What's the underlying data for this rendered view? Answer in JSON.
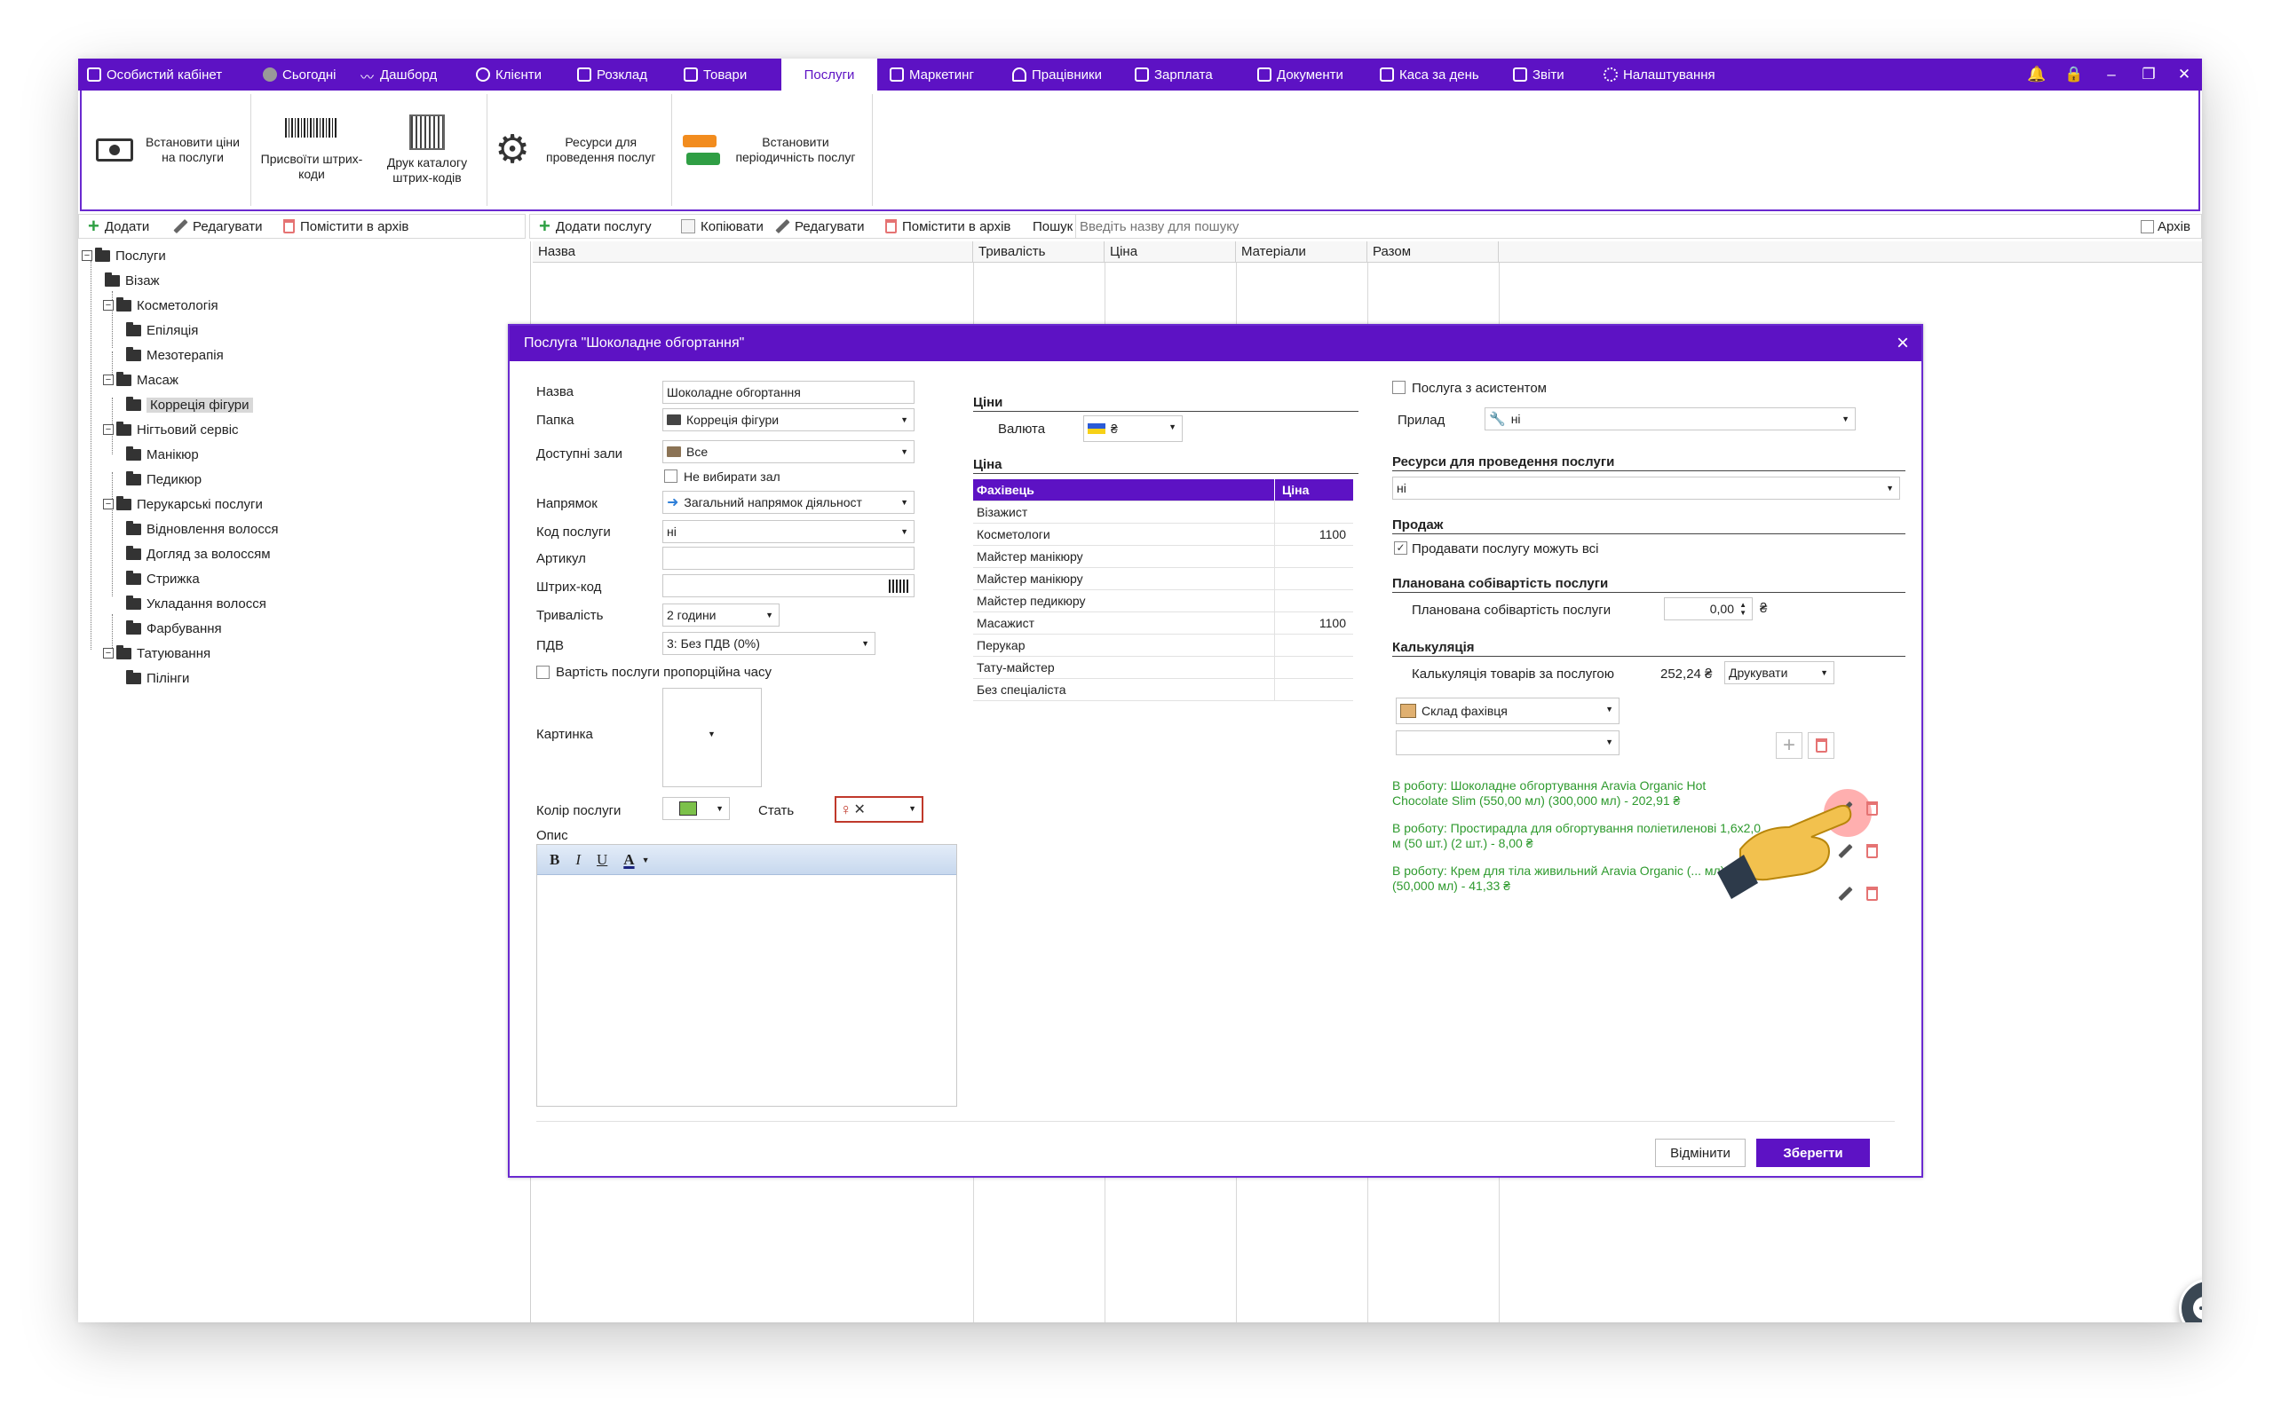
{
  "menu": {
    "items": [
      {
        "id": "cabinet",
        "label": "Особистий кабінет"
      },
      {
        "id": "today",
        "label": "Сьогодні"
      },
      {
        "id": "dashboard",
        "label": "Дашборд"
      },
      {
        "id": "clients",
        "label": "Клієнти"
      },
      {
        "id": "schedule",
        "label": "Розклад"
      },
      {
        "id": "goods",
        "label": "Товари"
      },
      {
        "id": "services",
        "label": "Послуги"
      },
      {
        "id": "marketing",
        "label": "Маркетинг"
      },
      {
        "id": "staff",
        "label": "Працівники"
      },
      {
        "id": "salary",
        "label": "Зарплата"
      },
      {
        "id": "documents",
        "label": "Документи"
      },
      {
        "id": "cashday",
        "label": "Каса за день"
      },
      {
        "id": "reports",
        "label": "Звіти"
      },
      {
        "id": "settings",
        "label": "Налаштування"
      }
    ],
    "active": "Послуги"
  },
  "ribbon": {
    "set_prices": "Встановити ціни на послуги",
    "assign_barcodes": "Присвоїти штрих-коди",
    "print_barcodes": "Друк каталогу штрих-кодів",
    "resources": "Ресурси для проведення послуг",
    "periodicity": "Встановити періодичність послуг"
  },
  "left_toolbar": {
    "add": "Додати",
    "edit": "Редагувати",
    "archive": "Помістити в архів"
  },
  "main_toolbar": {
    "add_service": "Додати послугу",
    "copy": "Копіювати",
    "edit": "Редагувати",
    "archive": "Помістити в архів",
    "search_label": "Пошук",
    "search_placeholder": "Введіть назву для пошуку",
    "archive_toggle": "Архів"
  },
  "tree": {
    "root": "Послуги",
    "visage": "Візаж",
    "cosmetology": "Косметологія",
    "epilation": "Епіляція",
    "mesotherapy": "Мезотерапія",
    "massage": "Масаж",
    "correction": "Корреція фігури",
    "nail": "Нігтьовий сервіс",
    "manicure": "Манікюр",
    "pedicure": "Педикюр",
    "hair": "Перукарські послуги",
    "hair_restore": "Відновлення волосся",
    "hair_care": "Догляд за волоссям",
    "haircut": "Стрижка",
    "styling": "Укладання волосся",
    "coloring": "Фарбування",
    "tattoo": "Татуювання",
    "peeling": "Пілінги"
  },
  "grid": {
    "columns": [
      "Назва",
      "Тривалість",
      "Ціна",
      "Матеріали",
      "Разом"
    ]
  },
  "dialog": {
    "title": "Послуга \"Шоколадне обгортання\"",
    "close": "×",
    "labels": {
      "name": "Назва",
      "folder": "Папка",
      "halls": "Доступні зали",
      "direction": "Напрямок",
      "code": "Код послуги",
      "article": "Артикул",
      "barcode": "Штрих-код",
      "duration": "Тривалість",
      "vat": "ПДВ",
      "picture": "Картинка",
      "color": "Колір послуги",
      "gender": "Стать",
      "description": "Опис"
    },
    "values": {
      "name": "Шоколадне обгортання",
      "folder": "Корреція фігури",
      "halls": "Все",
      "no_halls": "Не вибирати зал",
      "direction": "Загальний напрямок діяльност",
      "code": "ні",
      "article": "",
      "barcode": "",
      "duration": "2 години",
      "vat": "3: Без ПДВ (0%)",
      "proportional": "Вартість послуги пропорційна часу"
    },
    "color_service": "#7cc14a",
    "editor": {
      "bold": "B",
      "italic": "I",
      "underline": "U",
      "fontcolor": "A"
    },
    "prices": {
      "section": "Ціни",
      "currency_label": "Валюта",
      "currency_value": "₴",
      "price_section": "Ціна",
      "table_head": {
        "specialist": "Фахівець",
        "price": "Ціна"
      },
      "rows": [
        {
          "specialist": "Візажист",
          "price": ""
        },
        {
          "specialist": "Косметологи",
          "price": "1100"
        },
        {
          "specialist": "Майстер манікюру",
          "price": ""
        },
        {
          "specialist": "Майстер манікюру",
          "price": ""
        },
        {
          "specialist": "Майстер педикюру",
          "price": ""
        },
        {
          "specialist": "Масажист",
          "price": "1100"
        },
        {
          "specialist": "Перукар",
          "price": ""
        },
        {
          "specialist": "Тату-майстер",
          "price": ""
        },
        {
          "specialist": "Без спеціаліста",
          "price": ""
        }
      ]
    },
    "right": {
      "assistant": "Послуга з асистентом",
      "device_label": "Прилад",
      "device_value": "ні",
      "resources_section": "Ресурси для проведення послуги",
      "resources_value": "ні",
      "sale_section": "Продаж",
      "sale_all": "Продавати послугу можуть всі",
      "cost_section": "Планована собівартість послуги",
      "cost_label": "Планована собівартість послуги",
      "cost_value": "0,00",
      "cost_currency": "₴",
      "calc_section": "Калькуляція",
      "calc_label": "Калькуляція товарів за послугою",
      "calc_value": "252,24 ₴",
      "print": "Друкувати",
      "warehouse": "Склад фахівця",
      "items": [
        {
          "text": "В роботу: Шоколадне обгортування Aravia Organic Hot Chocolate Slim (550,00 мл) (300,000 мл) - 202,91 ₴"
        },
        {
          "text": "В роботу: Простирадла для обгортування поліетиленові 1,6х2,0 м (50 шт.) (2 шт.) - 8,00 ₴"
        },
        {
          "text": "В роботу: Крем для тіла живильний Aravia Organic (... мл) (50,000 мл) - 41,33 ₴"
        }
      ]
    },
    "buttons": {
      "cancel": "Відмінити",
      "save": "Зберегти"
    }
  },
  "colors": {
    "brand": "#5d12c4",
    "accent_green": "#2e9a2e",
    "danger": "#e57373"
  }
}
